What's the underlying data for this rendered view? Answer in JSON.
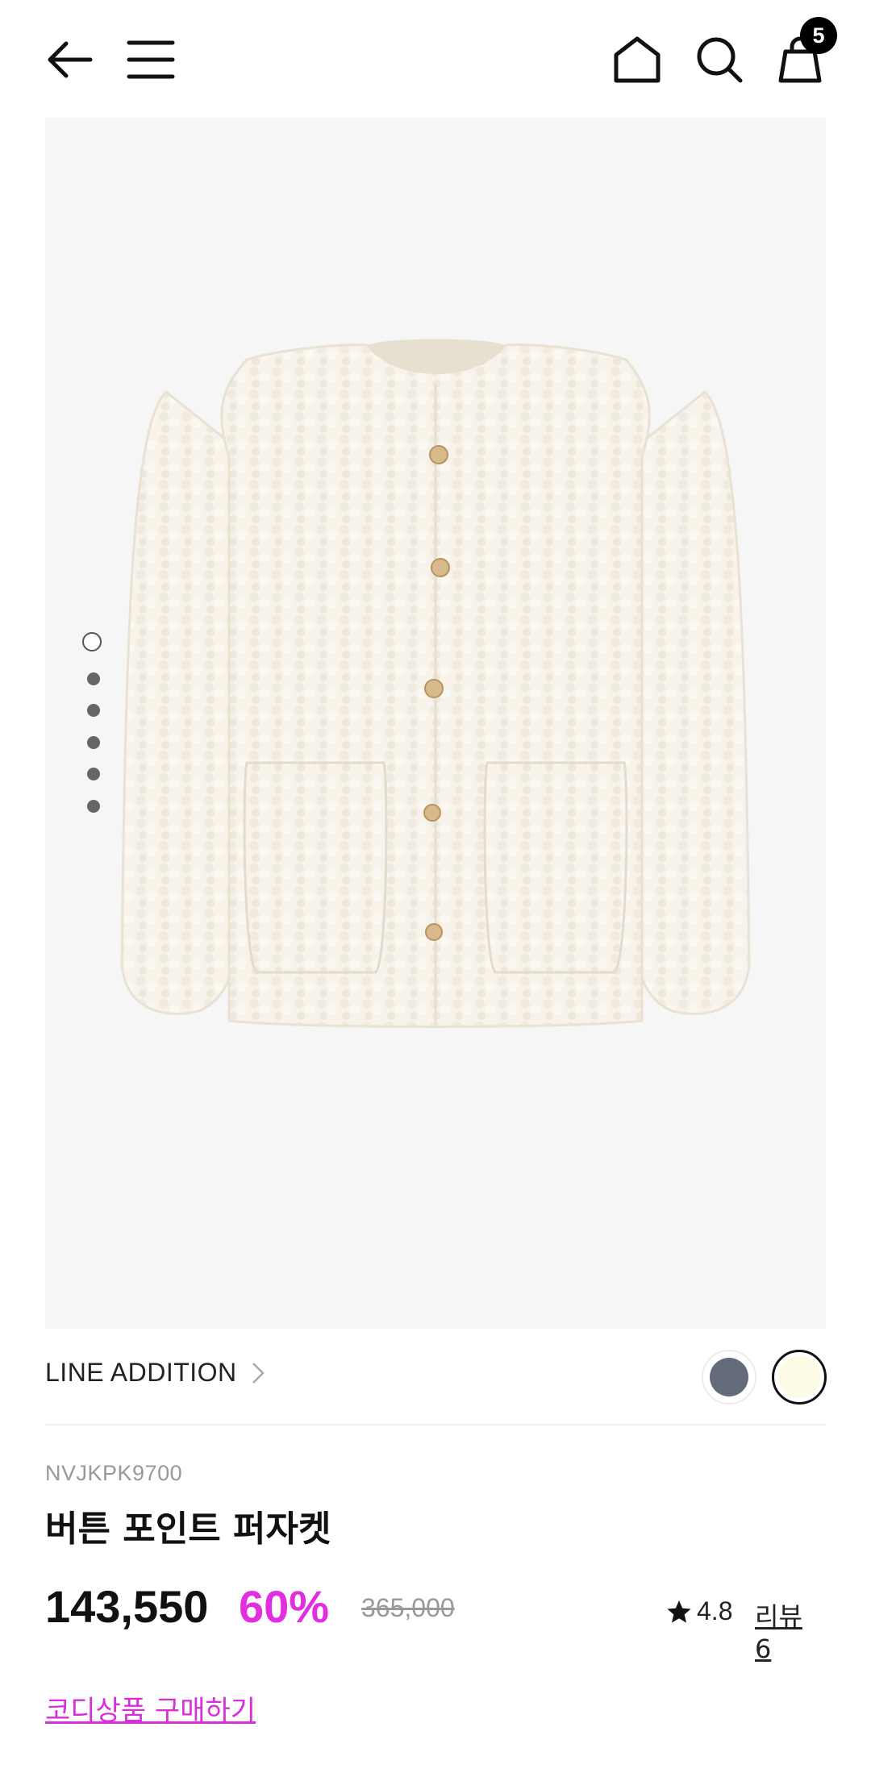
{
  "header": {
    "back_icon": "arrow-left-icon",
    "menu_icon": "hamburger-menu-icon",
    "home_icon": "home-icon",
    "search_icon": "search-icon",
    "cart_icon": "shopping-bag-icon",
    "cart_count": "5"
  },
  "gallery": {
    "image_count": 6,
    "active_index": 0,
    "background": "#f6f6f6"
  },
  "brand": {
    "name": "LINE ADDITION",
    "colors": [
      {
        "name": "navy",
        "hex": "#636b7b",
        "selected": false
      },
      {
        "name": "ivory",
        "hex": "#fdfbe6",
        "selected": true
      }
    ]
  },
  "product": {
    "code": "NVJKPK9700",
    "name": "버튼 포인트 퍼자켓",
    "price": "143,550",
    "discount": "60%",
    "original_price": "365,000",
    "rating": "4.8",
    "review_label": "리뷰 6",
    "coordi_link": "코디상품 구매하기"
  },
  "colors": {
    "accent": "#e02ee0",
    "text": "#111111",
    "muted": "#999999"
  }
}
